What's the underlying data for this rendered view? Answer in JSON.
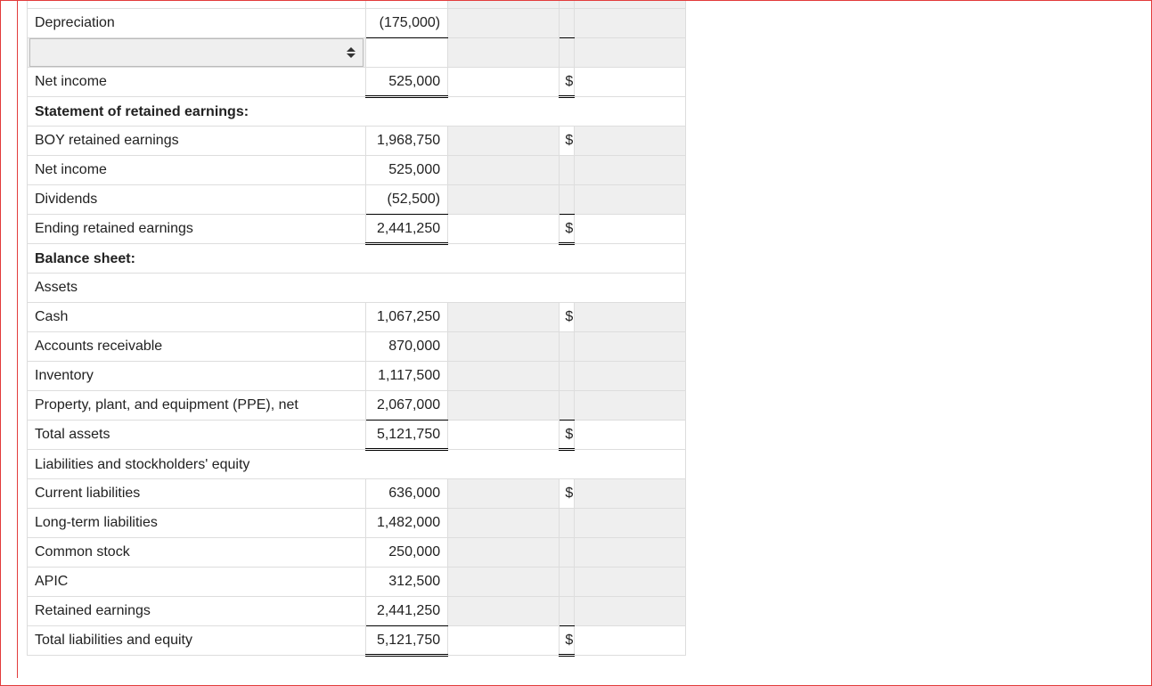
{
  "currency": "$",
  "rows": {
    "depreciation": {
      "label": "Depreciation",
      "v1": "(175,000)"
    },
    "net_income_1": {
      "label": "Net income",
      "v1": "525,000"
    },
    "stmt_re_head": {
      "label": "Statement of retained earnings:"
    },
    "boy_re": {
      "label": "BOY retained earnings",
      "v1": "1,968,750"
    },
    "net_income_2": {
      "label": "Net income",
      "v1": "525,000"
    },
    "dividends": {
      "label": "Dividends",
      "v1": "(52,500)"
    },
    "end_re": {
      "label": "Ending retained earnings",
      "v1": "2,441,250"
    },
    "bs_head": {
      "label": "Balance sheet:"
    },
    "assets_head": {
      "label": "Assets"
    },
    "cash": {
      "label": "Cash",
      "v1": "1,067,250"
    },
    "ar": {
      "label": "Accounts receivable",
      "v1": "870,000"
    },
    "inventory": {
      "label": "Inventory",
      "v1": "1,117,500"
    },
    "ppe": {
      "label": "Property, plant, and equipment (PPE), net",
      "v1": "2,067,000"
    },
    "total_assets": {
      "label": "Total assets",
      "v1": "5,121,750"
    },
    "liab_eq_head": {
      "label": "Liabilities and stockholders' equity"
    },
    "cur_liab": {
      "label": "Current liabilities",
      "v1": "636,000"
    },
    "lt_liab": {
      "label": "Long-term liabilities",
      "v1": "1,482,000"
    },
    "common": {
      "label": "Common stock",
      "v1": "250,000"
    },
    "apic": {
      "label": "APIC",
      "v1": "312,500"
    },
    "ret_earn": {
      "label": "Retained earnings",
      "v1": "2,441,250"
    },
    "tle": {
      "label": "Total liabilities and equity",
      "v1": "5,121,750"
    }
  }
}
